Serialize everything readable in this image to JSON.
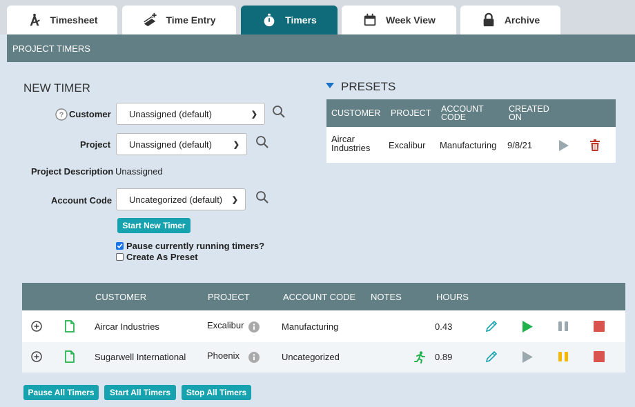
{
  "tabs": [
    {
      "label": "Timesheet",
      "icon": "compass-icon",
      "active": false
    },
    {
      "label": "Time Entry",
      "icon": "add-entry-icon",
      "active": false
    },
    {
      "label": "Timers",
      "icon": "stopwatch-icon",
      "active": true
    },
    {
      "label": "Week View",
      "icon": "calendar-icon",
      "active": false
    },
    {
      "label": "Archive",
      "icon": "lock-icon",
      "active": false
    }
  ],
  "header": {
    "title": "PROJECT TIMERS"
  },
  "new_timer": {
    "title": "NEW TIMER",
    "customer_label": "Customer",
    "customer_value": "Unassigned (default)",
    "project_label": "Project",
    "project_value": "Unassigned (default)",
    "project_description_label": "Project Description",
    "project_description_value": "Unassigned",
    "account_code_label": "Account Code",
    "account_code_value": "Uncategorized (default)",
    "start_button": "Start New Timer",
    "pause_running_label": "Pause currently running timers?",
    "pause_running_checked": true,
    "create_preset_label": "Create As Preset",
    "create_preset_checked": false
  },
  "presets": {
    "title": "PRESETS",
    "headers": {
      "customer": "CUSTOMER",
      "project": "PROJECT",
      "account_code_1": "ACCOUNT",
      "account_code_2": "CODE",
      "created_1": "CREATED",
      "created_2": "ON"
    },
    "rows": [
      {
        "customer_1": "Aircar",
        "customer_2": "Industries",
        "project": "Excalibur",
        "account_code": "Manufacturing",
        "created_on": "9/8/21"
      }
    ]
  },
  "timers": {
    "headers": {
      "customer": "CUSTOMER",
      "project": "PROJECT",
      "account_code": "ACCOUNT CODE",
      "notes": "NOTES",
      "hours": "HOURS"
    },
    "rows": [
      {
        "customer": "Aircar Industries",
        "project": "Excalibur",
        "account_code": "Manufacturing",
        "notes": "",
        "hours": "0.43",
        "running": true
      },
      {
        "customer": "Sugarwell International",
        "project": "Phoenix",
        "account_code": "Uncategorized",
        "notes": "",
        "hours": "0.89",
        "running": false,
        "paused": true
      }
    ]
  },
  "footer_buttons": {
    "pause_all": "Pause All Timers",
    "start_all": "Start All Timers",
    "stop_all": "Stop All Timers"
  },
  "colors": {
    "accent": "#17a2b0",
    "header": "#627f85",
    "active_tab": "#0f6b7a",
    "play_active": "#22b14c",
    "pause_active": "#f5b800",
    "stop": "#d9534f",
    "delete": "#c0392b"
  }
}
